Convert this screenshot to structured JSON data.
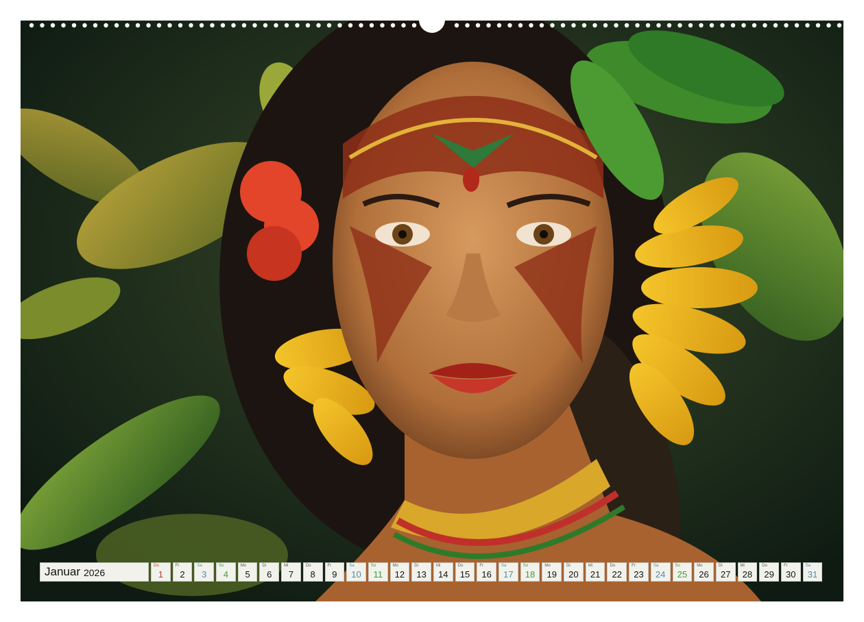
{
  "calendar": {
    "month": "Januar",
    "year": "2026",
    "days": [
      {
        "wd": "Do",
        "n": "1",
        "kind": "hol"
      },
      {
        "wd": "Fr",
        "n": "2",
        "kind": ""
      },
      {
        "wd": "Sa",
        "n": "3",
        "kind": "sat"
      },
      {
        "wd": "So",
        "n": "4",
        "kind": "sun"
      },
      {
        "wd": "Mo",
        "n": "5",
        "kind": ""
      },
      {
        "wd": "Di",
        "n": "6",
        "kind": ""
      },
      {
        "wd": "Mi",
        "n": "7",
        "kind": ""
      },
      {
        "wd": "Do",
        "n": "8",
        "kind": ""
      },
      {
        "wd": "Fr",
        "n": "9",
        "kind": ""
      },
      {
        "wd": "Sa",
        "n": "10",
        "kind": "sat"
      },
      {
        "wd": "So",
        "n": "11",
        "kind": "sun"
      },
      {
        "wd": "Mo",
        "n": "12",
        "kind": ""
      },
      {
        "wd": "Di",
        "n": "13",
        "kind": ""
      },
      {
        "wd": "Mi",
        "n": "14",
        "kind": ""
      },
      {
        "wd": "Do",
        "n": "15",
        "kind": ""
      },
      {
        "wd": "Fr",
        "n": "16",
        "kind": ""
      },
      {
        "wd": "Sa",
        "n": "17",
        "kind": "sat"
      },
      {
        "wd": "So",
        "n": "18",
        "kind": "sun"
      },
      {
        "wd": "Mo",
        "n": "19",
        "kind": ""
      },
      {
        "wd": "Di",
        "n": "20",
        "kind": ""
      },
      {
        "wd": "Mi",
        "n": "21",
        "kind": ""
      },
      {
        "wd": "Do",
        "n": "22",
        "kind": ""
      },
      {
        "wd": "Fr",
        "n": "23",
        "kind": ""
      },
      {
        "wd": "Sa",
        "n": "24",
        "kind": "sat"
      },
      {
        "wd": "So",
        "n": "25",
        "kind": "sun"
      },
      {
        "wd": "Mo",
        "n": "26",
        "kind": ""
      },
      {
        "wd": "Di",
        "n": "27",
        "kind": ""
      },
      {
        "wd": "Mi",
        "n": "28",
        "kind": ""
      },
      {
        "wd": "Do",
        "n": "29",
        "kind": ""
      },
      {
        "wd": "Fr",
        "n": "30",
        "kind": ""
      },
      {
        "wd": "Sa",
        "n": "31",
        "kind": "sat"
      }
    ]
  },
  "colors": {
    "saturday": "#4e8ea6",
    "sunday": "#3f9b3a",
    "holiday": "#c0392b"
  }
}
